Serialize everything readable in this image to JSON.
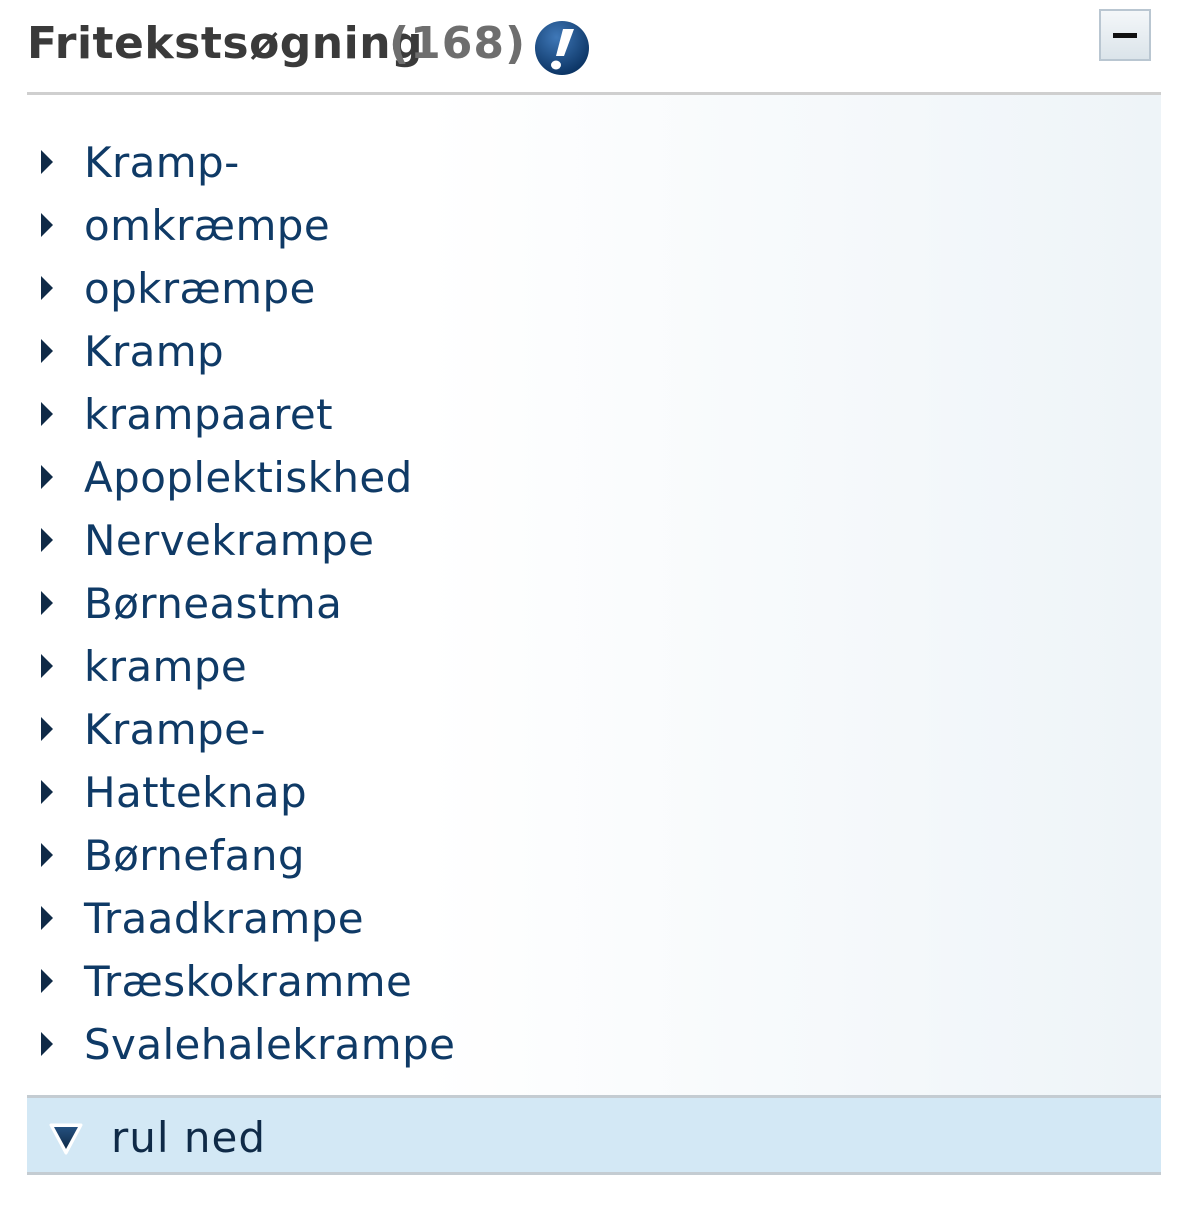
{
  "header": {
    "title": "Fritekstsøgning",
    "count": "(168)",
    "help_icon": "info-exclamation-icon",
    "collapse_icon": "minus-icon"
  },
  "results": [
    "Kramp-",
    "omkræmpe",
    "opkræmpe",
    "Kramp",
    "krampaaret",
    "Apoplektiskhed",
    "Nervekrampe",
    "Børneastma",
    "krampe",
    "Krampe-",
    "Hatteknap",
    "Børnefang",
    "Traadkrampe",
    "Træskokramme",
    "Svalehalekrampe"
  ],
  "footer": {
    "scroll_label": "rul ned",
    "scroll_icon": "triangle-down-icon"
  },
  "colors": {
    "link": "#0f3a66",
    "header_text": "#3a3a3a",
    "count_text": "#6e6e6e",
    "footer_bg": "#d3e8f5",
    "icon_blue": "#1a4f8a"
  }
}
